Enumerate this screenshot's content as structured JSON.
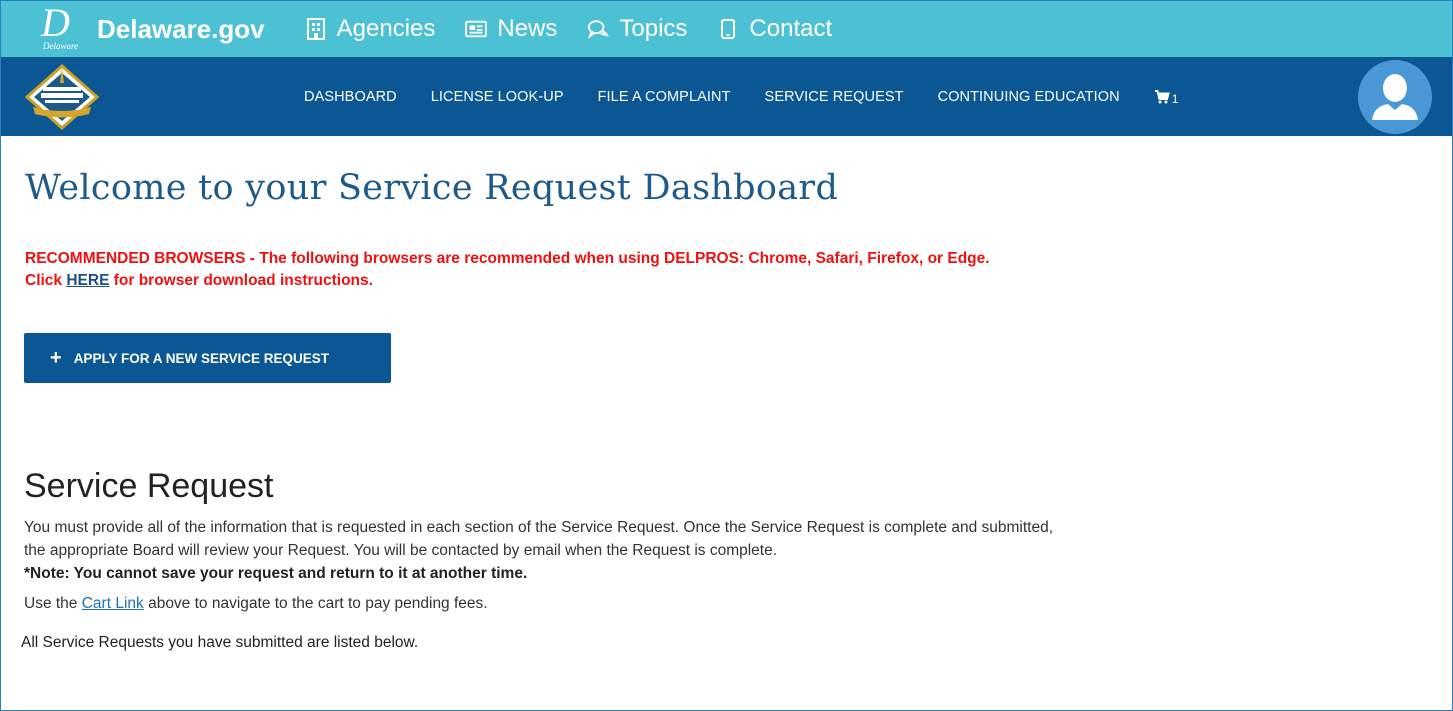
{
  "gov_bar": {
    "seal_letter": "D",
    "seal_text": "Delaware",
    "title": "Delaware.gov",
    "links": [
      {
        "label": "Agencies",
        "icon": "building-icon"
      },
      {
        "label": "News",
        "icon": "newspaper-icon"
      },
      {
        "label": "Topics",
        "icon": "chat-icon"
      },
      {
        "label": "Contact",
        "icon": "phone-icon"
      }
    ]
  },
  "nav": {
    "items": [
      {
        "label": "DASHBOARD"
      },
      {
        "label": "LICENSE LOOK-UP"
      },
      {
        "label": "FILE A COMPLAINT"
      },
      {
        "label": "SERVICE REQUEST"
      },
      {
        "label": "CONTINUING EDUCATION"
      }
    ],
    "cart_count": "1"
  },
  "main": {
    "title": "Welcome to your Service Request Dashboard",
    "warning_line1": "RECOMMENDED BROWSERS - The following browsers are recommended when using DELPROS: Chrome, Safari, Firefox, or Edge.",
    "warning_click": "Click ",
    "warning_link": "HERE",
    "warning_after": " for browser download instructions.",
    "apply_button": "APPLY FOR A NEW SERVICE REQUEST",
    "section_title": "Service Request",
    "body_line1": "You must provide all of the information that is requested in each section of the Service Request. Once the Service Request is complete and submitted,",
    "body_line2": "the appropriate Board will review your Request. You will be contacted by email when the Request is complete.",
    "note": "*Note: You cannot save your request and return to it at another time.",
    "cart_before": "Use the ",
    "cart_link": "Cart Link",
    "cart_after": " above to navigate to the cart to pay pending fees.",
    "listed": "All Service Requests you have submitted are listed below."
  },
  "colors": {
    "gov_bar": "#4dc1d4",
    "nav_bar": "#0b5794",
    "title": "#1d5a8a",
    "warning": "#ee1111",
    "button": "#0b5794"
  }
}
